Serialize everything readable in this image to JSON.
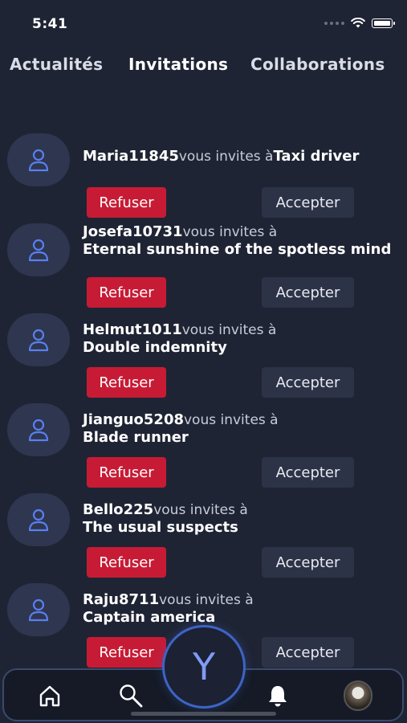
{
  "status_bar": {
    "time": "5:41"
  },
  "tabs": [
    {
      "label": "Actualités",
      "active": false
    },
    {
      "label": "Invitations",
      "active": true
    },
    {
      "label": "Collaborations",
      "active": false
    }
  ],
  "invites": [
    {
      "user": "Maria11845",
      "text": "vous invites à",
      "film": "Taxi driver",
      "refuse": "Refuser",
      "accept": "Accepter"
    },
    {
      "user": "Josefa10731",
      "text": "vous invites à",
      "film": "Eternal sunshine of the spotless mind",
      "refuse": "Refuser",
      "accept": "Accepter"
    },
    {
      "user": "Helmut1011",
      "text": "vous invites à",
      "film": "Double indemnity",
      "refuse": "Refuser",
      "accept": "Accepter"
    },
    {
      "user": "Jianguo5208",
      "text": "vous invites à",
      "film": "Blade runner",
      "refuse": "Refuser",
      "accept": "Accepter"
    },
    {
      "user": "Bello225",
      "text": "vous invites à",
      "film": "The usual suspects",
      "refuse": "Refuser",
      "accept": "Accepter"
    },
    {
      "user": "Raju8711",
      "text": "vous invites à",
      "film": "Captain america",
      "refuse": "Refuser",
      "accept": "Accepter"
    }
  ],
  "center_button": {
    "label": "Y"
  },
  "nav": [
    {
      "icon": "home-icon"
    },
    {
      "icon": "search-icon"
    },
    {
      "icon": "bell-icon"
    },
    {
      "icon": "profile-avatar"
    }
  ],
  "colors": {
    "background": "#1f2434",
    "refuse": "#c71b35",
    "accept": "#2c3347",
    "accent": "#5a7ff0"
  }
}
